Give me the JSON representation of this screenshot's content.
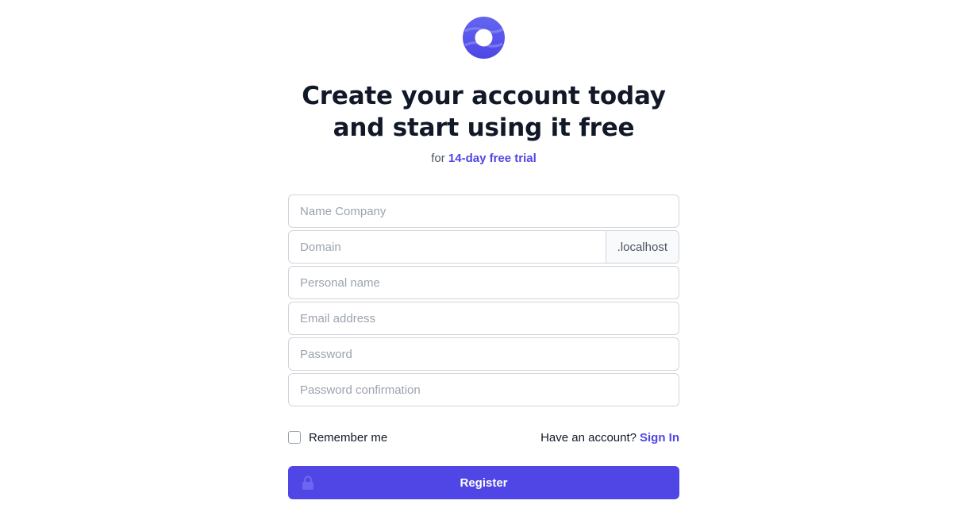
{
  "header": {
    "logo_icon": "brand-logo-icon",
    "headline_line1": "Create your account today",
    "headline_line2": "and start using it free",
    "sub_prefix": "for",
    "sub_accent": "14-day free trial"
  },
  "form": {
    "company_placeholder": "Name Company",
    "domain_placeholder": "Domain",
    "domain_suffix": ".localhost",
    "personal_name_placeholder": "Personal name",
    "email_placeholder": "Email address",
    "password_placeholder": "Password",
    "password_confirmation_placeholder": "Password confirmation",
    "remember_label": "Remember me",
    "have_account_text": "Have an account?",
    "signin_label": "Sign In",
    "register_label": "Register",
    "register_icon": "lock-icon"
  },
  "colors": {
    "accent": "#4f46e5",
    "heading": "#111827",
    "placeholder": "#9ca3af",
    "border": "#d1d5db"
  }
}
